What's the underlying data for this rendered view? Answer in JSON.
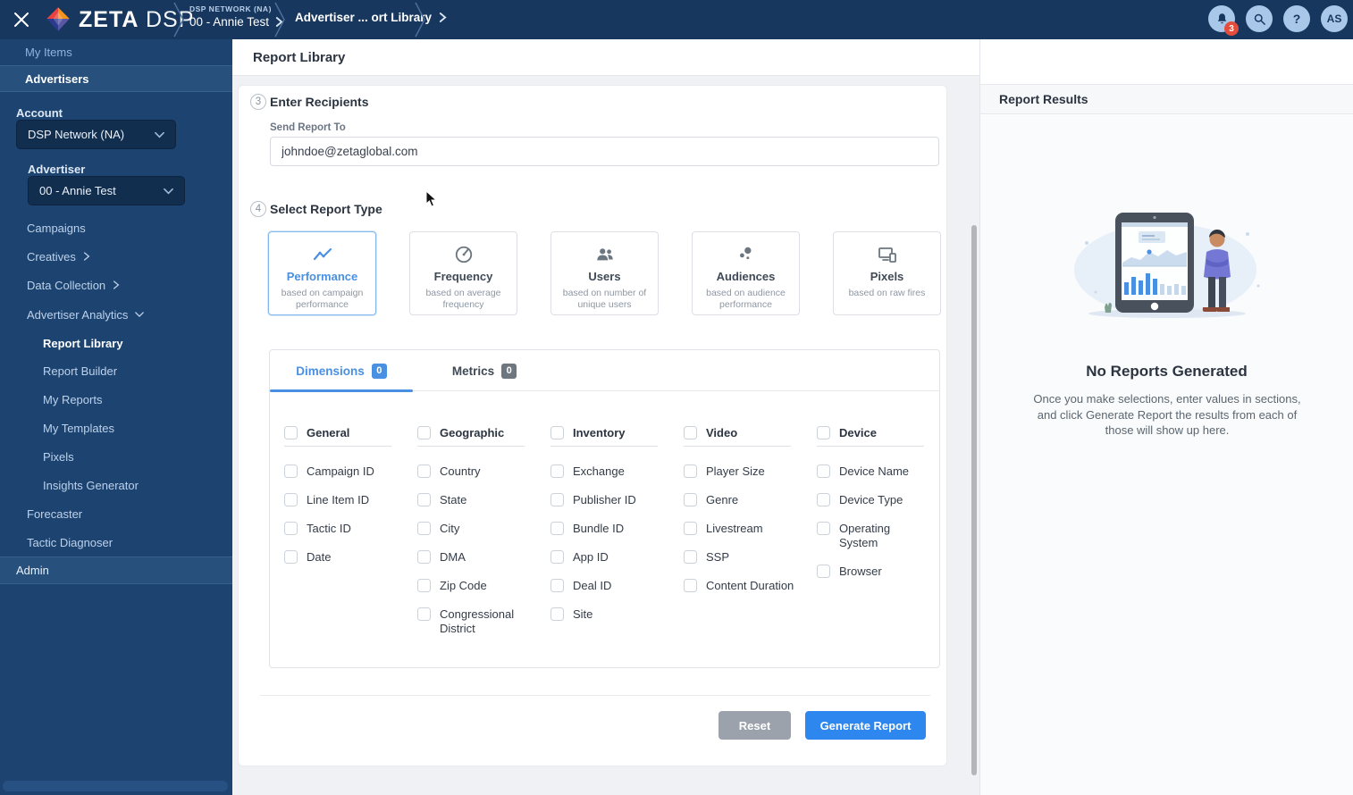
{
  "topbar": {
    "brand": "ZETA",
    "product": "DSP",
    "breadcrumbs": {
      "network_eyebrow": "DSP NETWORK (NA)",
      "network_label": "00 - Annie Test",
      "page_label": "Advertiser ... ort Library"
    },
    "notification_count": "3",
    "avatar_initials": "AS",
    "help_glyph": "?"
  },
  "sidebar": {
    "my_items": "My Items",
    "advertisers": "Advertisers",
    "account_label": "Account",
    "account_value": "DSP Network (NA)",
    "advertiser_label": "Advertiser",
    "advertiser_value": "00 - Annie Test",
    "nav": [
      {
        "label": "Campaigns"
      },
      {
        "label": "Creatives"
      },
      {
        "label": "Data Collection"
      },
      {
        "label": "Advertiser Analytics"
      },
      {
        "label": "Report Library"
      },
      {
        "label": "Report Builder"
      },
      {
        "label": "My Reports"
      },
      {
        "label": "My Templates"
      },
      {
        "label": "Pixels"
      },
      {
        "label": "Insights Generator"
      },
      {
        "label": "Forecaster"
      },
      {
        "label": "Tactic Diagnoser"
      }
    ],
    "admin": "Admin"
  },
  "main": {
    "title": "Report Library",
    "step3": {
      "number": "3",
      "title": "Enter Recipients"
    },
    "recipients": {
      "label": "Send Report To",
      "value": "johndoe@zetaglobal.com"
    },
    "step4": {
      "number": "4",
      "title": "Select Report Type"
    },
    "report_types": [
      {
        "title": "Performance",
        "subtitle": "based on campaign performance",
        "selected": true
      },
      {
        "title": "Frequency",
        "subtitle": "based on average frequency",
        "selected": false
      },
      {
        "title": "Users",
        "subtitle": "based on number of unique users",
        "selected": false
      },
      {
        "title": "Audiences",
        "subtitle": "based on audience performance",
        "selected": false
      },
      {
        "title": "Pixels",
        "subtitle": "based on raw fires",
        "selected": false
      }
    ],
    "tabs": [
      {
        "label": "Dimensions",
        "count": "0"
      },
      {
        "label": "Metrics",
        "count": "0"
      }
    ],
    "groups": [
      {
        "label": "General",
        "items": [
          "Campaign ID",
          "Line Item ID",
          "Tactic ID",
          "Date"
        ]
      },
      {
        "label": "Geographic",
        "items": [
          "Country",
          "State",
          "City",
          "DMA",
          "Zip Code",
          "Congressional District"
        ]
      },
      {
        "label": "Inventory",
        "items": [
          "Exchange",
          "Publisher ID",
          "Bundle ID",
          "App ID",
          "Deal ID",
          "Site"
        ]
      },
      {
        "label": "Video",
        "items": [
          "Player Size",
          "Genre",
          "Livestream",
          "SSP",
          "Content Duration"
        ]
      },
      {
        "label": "Device",
        "items": [
          "Device Name",
          "Device Type",
          "Operating System",
          "Browser"
        ]
      }
    ],
    "reset_label": "Reset",
    "generate_label": "Generate Report"
  },
  "results": {
    "title": "Report Results",
    "empty_title": "No Reports Generated",
    "empty_body": "Once you make selections, enter values in sections, and click Generate Report the results from each of those will show up here."
  },
  "colors": {
    "topbar": "#17375e",
    "sidebar": "#1d4371",
    "accent_blue": "#4a90e2",
    "button_blue": "#2e87ee",
    "badge_red": "#e44d3c"
  }
}
